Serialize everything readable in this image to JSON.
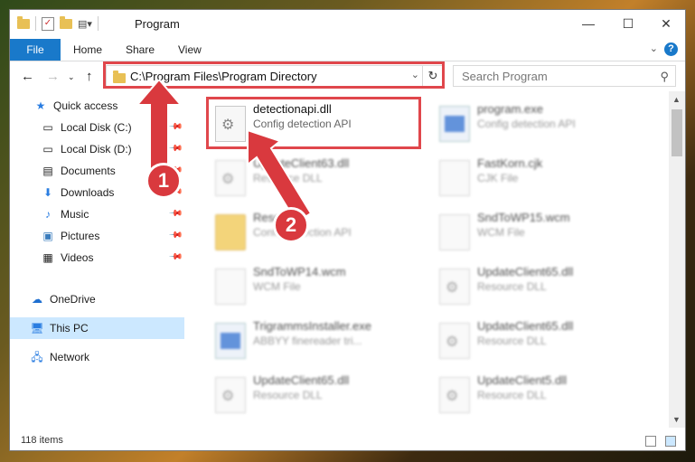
{
  "window": {
    "title": "Program",
    "controls": {
      "minimize": "—",
      "maximize": "☐",
      "close": "✕"
    }
  },
  "ribbon": {
    "tabs": [
      "File",
      "Home",
      "Share",
      "View"
    ],
    "help": "?"
  },
  "address_bar": {
    "path": "C:\\Program Files\\Program Directory"
  },
  "search": {
    "placeholder": "Search Program"
  },
  "sidebar": {
    "items": [
      {
        "label": "Quick access",
        "icon": "star-icon"
      },
      {
        "label": "Local Disk (C:)",
        "icon": "drive-icon"
      },
      {
        "label": "Local Disk (D:)",
        "icon": "drive-icon"
      },
      {
        "label": "Documents",
        "icon": "documents-icon"
      },
      {
        "label": "Downloads",
        "icon": "downloads-icon"
      },
      {
        "label": "Music",
        "icon": "music-icon"
      },
      {
        "label": "Pictures",
        "icon": "pictures-icon"
      },
      {
        "label": "Videos",
        "icon": "videos-icon"
      },
      {
        "label": "OneDrive",
        "icon": "cloud-icon"
      },
      {
        "label": "This PC",
        "icon": "computer-icon",
        "selected": true
      },
      {
        "label": "Network",
        "icon": "network-icon"
      }
    ]
  },
  "files": [
    {
      "name": "detectionapi.dll",
      "desc": "Config detection API",
      "icon": "gear"
    },
    {
      "name": "program.exe",
      "desc": "Config detection API",
      "icon": "exe"
    },
    {
      "name": "UpdateClient63.dll",
      "desc": "Resource DLL",
      "icon": "gear"
    },
    {
      "name": "FastKorn.cjk",
      "desc": "CJK File",
      "icon": "doc"
    },
    {
      "name": "Resource",
      "desc": "Config detection API",
      "icon": "folder"
    },
    {
      "name": "SndToWP15.wcm",
      "desc": "WCM File",
      "icon": "doc"
    },
    {
      "name": "SndToWP14.wcm",
      "desc": "WCM File",
      "icon": "doc"
    },
    {
      "name": "UpdateClient65.dll",
      "desc": "Resource DLL",
      "icon": "gear"
    },
    {
      "name": "TrigrammsInstaller.exe",
      "desc": "ABBYY finereader tri...",
      "icon": "exe"
    },
    {
      "name": "UpdateClient65.dll",
      "desc": "Resource DLL",
      "icon": "gear"
    },
    {
      "name": "UpdateClient65.dll",
      "desc": "Resource DLL",
      "icon": "gear"
    },
    {
      "name": "UpdateClient5.dll",
      "desc": "Resource DLL",
      "icon": "gear"
    }
  ],
  "status": {
    "item_count": "118 items"
  },
  "annotations": {
    "badge1": "1",
    "badge2": "2",
    "color": "#d9393e"
  }
}
